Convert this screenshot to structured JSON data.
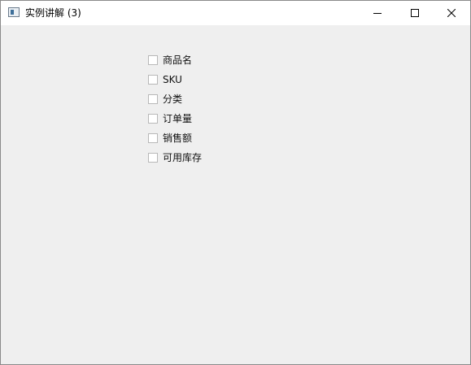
{
  "window": {
    "title": "实例讲解 (3)"
  },
  "titlebar_icons": [
    "app-icon",
    "minimize-icon",
    "maximize-icon",
    "close-icon"
  ],
  "checkboxes": [
    {
      "label": "商品名",
      "checked": false
    },
    {
      "label": "SKU",
      "checked": false
    },
    {
      "label": "分类",
      "checked": false
    },
    {
      "label": "订单量",
      "checked": false
    },
    {
      "label": "销售额",
      "checked": false
    },
    {
      "label": "可用库存",
      "checked": false
    }
  ]
}
